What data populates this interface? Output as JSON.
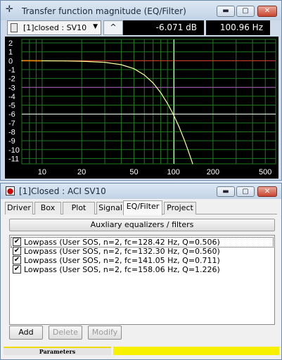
{
  "window1": {
    "title": "Transfer function magnitude (EQ/Filter)",
    "title_icon": "crosshair-icon",
    "combo_value": "[1]closed : SV10",
    "marker_symbol": "^",
    "readout_db": "-6.071 dB",
    "readout_hz": "100.96 Hz"
  },
  "chart_data": {
    "type": "line",
    "title": "",
    "xlabel": "",
    "ylabel": "",
    "x_scale": "log",
    "xlim": [
      7,
      600
    ],
    "ylim": [
      -11.6,
      2.4
    ],
    "x_ticks": [
      10,
      20,
      50,
      100,
      200,
      500
    ],
    "x_tick_labels": [
      "10",
      "20",
      "50",
      "100",
      "200",
      "500"
    ],
    "y_ticks": [
      2,
      1,
      0,
      -1,
      -2,
      -3,
      -4,
      -5,
      -6,
      -7,
      -8,
      -9,
      -10,
      -11
    ],
    "y_tick_labels": [
      "2",
      "1",
      "0",
      "-1",
      "-2",
      "-3",
      "-4",
      "-5",
      "-6",
      "-7",
      "-8",
      "-9",
      "-10",
      "-11"
    ],
    "grid": true,
    "reference_lines": [
      {
        "axis": "y",
        "value": 0,
        "color": "#e03030"
      },
      {
        "axis": "y",
        "value": -3,
        "color": "#b04fc0"
      },
      {
        "axis": "y",
        "value": -6,
        "color": "#ffffff"
      },
      {
        "axis": "x",
        "value": 100.96,
        "color": "#ffffff"
      }
    ],
    "series": [
      {
        "color": "#ffff99",
        "x": [
          7,
          10,
          15,
          20,
          30,
          40,
          50,
          60,
          70,
          80,
          90,
          100,
          110,
          120,
          130,
          140
        ],
        "y": [
          0,
          -0.01,
          -0.03,
          -0.06,
          -0.18,
          -0.45,
          -0.9,
          -1.6,
          -2.5,
          -3.6,
          -4.8,
          -6.07,
          -7.4,
          -8.8,
          -10.2,
          -11.6
        ],
        "start_color": "#ff8c00"
      }
    ]
  },
  "window2": {
    "title": "[1]Closed : ACI SV10",
    "tabs": [
      "Driver",
      "Box",
      "Plot",
      "Signal",
      "EQ/Filter",
      "Project"
    ],
    "active_tab": "EQ/Filter",
    "aux_label": "Auxliary equalizers / filters",
    "filters": [
      {
        "label": "Lowpass (User SOS, n=2, fc=128.42 Hz, Q=0.506)",
        "checked": true
      },
      {
        "label": "Lowpass (User SOS, n=2, fc=132.30 Hz, Q=0.560)",
        "checked": true
      },
      {
        "label": "Lowpass (User SOS, n=2, fc=141.05 Hz, Q=0.711)",
        "checked": true
      },
      {
        "label": "Lowpass (User SOS, n=2, fc=158.06 Hz, Q=1.226)",
        "checked": true
      }
    ],
    "buttons": {
      "add": "Add",
      "delete": "Delete",
      "modify": "Modify"
    },
    "status_label": "Parameters"
  },
  "colors": {
    "plot_bg": "#000000",
    "grid": "#1f7a1f",
    "tick_label": "#ffffff",
    "curve": "#ffff99",
    "status_yellow": "#f7f100"
  }
}
